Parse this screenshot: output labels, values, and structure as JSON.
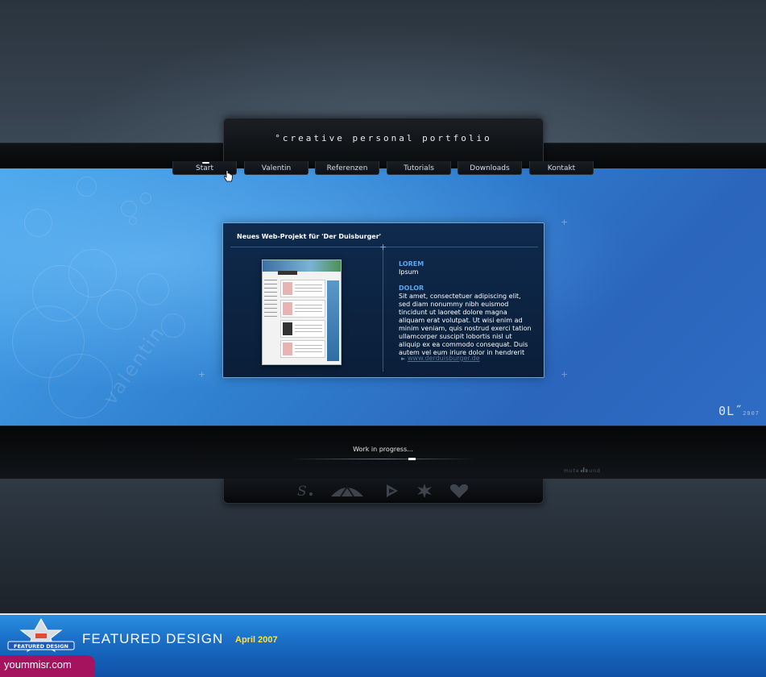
{
  "header": {
    "title": "°creative personal portfolio"
  },
  "nav": {
    "items": [
      {
        "label": "Start",
        "active": true
      },
      {
        "label": "Valentin",
        "active": false
      },
      {
        "label": "Referenzen",
        "active": false
      },
      {
        "label": "Tutorials",
        "active": false
      },
      {
        "label": "Downloads",
        "active": false
      },
      {
        "label": "Kontakt",
        "active": false
      }
    ]
  },
  "panel": {
    "title": "Neues Web-Projekt für 'Der Duisburger'",
    "section1_heading": "LOREM",
    "section1_text": "Ipsum",
    "section2_heading": "DOLOR",
    "section2_text": "Sit amet, consectetuer adipiscing elit, sed diam nonummy nibh euismod tincidunt ut laoreet dolore magna aliquam erat volutpat. Ut wisi enim ad minim veniam, quis nostrud exerci tation ullamcorper suscipit lobortis nisl ut aliquip ex ea commodo consequat. Duis autem vel eum iriure dolor in hendrerit",
    "link_text": "www.derduisburger.de"
  },
  "stage": {
    "logo": "0L˝",
    "logo_year": "2007",
    "watermark_word": "valentin"
  },
  "footer": {
    "progress_text": "Work in progress...",
    "mute_label": "mute sound",
    "social_icons": [
      "stumbleupon-icon",
      "deviantart-icon",
      "pixelgirl-icon",
      "star-icon",
      "heart-icon"
    ]
  },
  "banner": {
    "featured_text": "FEATURED DESIGN",
    "date": "April 2007",
    "badge_label": "FEATURED DESIGN",
    "watermark": "yoummisr.com"
  },
  "colors": {
    "accent_blue": "#5aa7f0",
    "stage_blue": "#2f7fcf",
    "date_yellow": "#ffe23a",
    "watermark_magenta": "#a5135f"
  }
}
